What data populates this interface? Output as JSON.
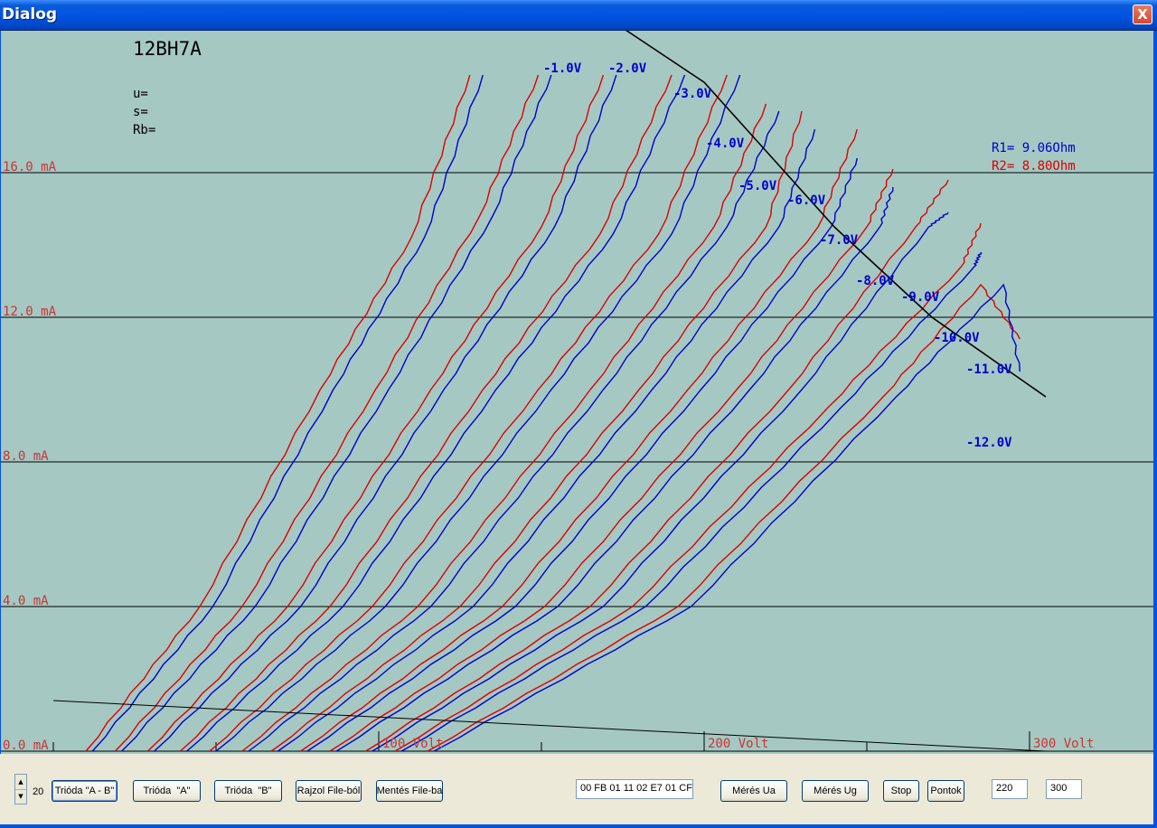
{
  "window": {
    "title": "Dialog",
    "close_label": "X"
  },
  "plot": {
    "tube_name": "12BH7A",
    "params": [
      "u=",
      "s=",
      "Rb="
    ],
    "r1_label": "R1= 9.06Ohm",
    "r2_label": "R2= 8.80Ohm",
    "y_tick_labels": [
      "16.0 mA",
      "12.0 mA",
      "8.0 mA",
      "4.0 mA",
      "0.0 mA"
    ],
    "x_tick_labels": [
      "100 Volt",
      "200 Volt",
      "300 Volt"
    ],
    "grid_labels": [
      "-1.0V",
      "-2.0V",
      "-3.0V",
      "-4.0V",
      "-5.0V",
      "-6.0V",
      "-7.0V",
      "-8.0V",
      "-9.0V",
      "-10.0V",
      "-11.0V",
      "-12.0V"
    ],
    "colors": {
      "background": "#a5c8c3",
      "triode_a": "#dd0000",
      "triode_b": "#0000cc",
      "axis_label": "#cc3333",
      "grid": "#000000"
    }
  },
  "chart_data": {
    "type": "line",
    "title": "12BH7A",
    "xlabel": "Volt",
    "ylabel": "mA",
    "xlim": [
      0,
      305
    ],
    "ylim": [
      0,
      16
    ],
    "x_ticks": [
      100,
      200,
      300
    ],
    "y_ticks": [
      0,
      4,
      8,
      12,
      16
    ],
    "grid": true,
    "series": [
      {
        "name": "-1.0V",
        "curves": [
          {
            "trace": "A",
            "points": [
              [
                10,
                0
              ],
              [
                45,
                4
              ],
              [
                82,
                10
              ],
              [
                110,
                14.2
              ],
              [
                128,
                18.7
              ]
            ]
          },
          {
            "trace": "B",
            "points": [
              [
                12,
                0
              ],
              [
                49,
                4
              ],
              [
                86,
                10
              ],
              [
                114,
                14.2
              ],
              [
                132,
                18.7
              ]
            ]
          }
        ]
      },
      {
        "name": "-2.0V",
        "curves": [
          {
            "trace": "A",
            "points": [
              [
                19,
                0
              ],
              [
                58,
                4
              ],
              [
                99,
                10
              ],
              [
                131,
                14.8
              ],
              [
                149,
                18.7
              ]
            ]
          },
          {
            "trace": "B",
            "points": [
              [
                21,
                0
              ],
              [
                62,
                4
              ],
              [
                103,
                10
              ],
              [
                135,
                14.8
              ],
              [
                153,
                18.7
              ]
            ]
          }
        ]
      },
      {
        "name": "-3.0V",
        "curves": [
          {
            "trace": "A",
            "points": [
              [
                29,
                0
              ],
              [
                72,
                4
              ],
              [
                116,
                10
              ],
              [
                150,
                14.5
              ],
              [
                169,
                18.7
              ]
            ]
          },
          {
            "trace": "B",
            "points": [
              [
                31,
                0
              ],
              [
                76,
                4
              ],
              [
                120,
                10
              ],
              [
                154,
                14.5
              ],
              [
                173,
                18.7
              ]
            ]
          }
        ]
      },
      {
        "name": "-4.0V",
        "curves": [
          {
            "trace": "A",
            "points": [
              [
                39,
                0
              ],
              [
                85,
                4
              ],
              [
                132,
                10
              ],
              [
                168,
                14.3
              ],
              [
                190,
                18.7
              ]
            ]
          },
          {
            "trace": "B",
            "points": [
              [
                41,
                0
              ],
              [
                89,
                4
              ],
              [
                136,
                10
              ],
              [
                172,
                14.3
              ],
              [
                194,
                18.7
              ]
            ]
          }
        ]
      },
      {
        "name": "-5.0V",
        "curves": [
          {
            "trace": "A",
            "points": [
              [
                48,
                0
              ],
              [
                98,
                4
              ],
              [
                149,
                10
              ],
              [
                186,
                14.3
              ],
              [
                207,
                18.7
              ]
            ]
          },
          {
            "trace": "B",
            "points": [
              [
                50,
                0
              ],
              [
                102,
                4
              ],
              [
                153,
                10
              ],
              [
                190,
                14.3
              ],
              [
                211,
                18.7
              ]
            ]
          }
        ]
      },
      {
        "name": "-6.0V",
        "curves": [
          {
            "trace": "A",
            "points": [
              [
                58,
                0
              ],
              [
                112,
                4
              ],
              [
                165,
                10
              ],
              [
                203,
                14.5
              ],
              [
                219,
                17.9
              ]
            ]
          },
          {
            "trace": "B",
            "points": [
              [
                60,
                0
              ],
              [
                116,
                4
              ],
              [
                169,
                10
              ],
              [
                207,
                14.5
              ],
              [
                223,
                17.7
              ]
            ]
          }
        ]
      },
      {
        "name": "-7.0V",
        "curves": [
          {
            "trace": "A",
            "points": [
              [
                67,
                0
              ],
              [
                125,
                4
              ],
              [
                180,
                10
              ],
              [
                219,
                14.5
              ],
              [
                230,
                17.7
              ]
            ]
          },
          {
            "trace": "B",
            "points": [
              [
                69,
                0
              ],
              [
                129,
                4
              ],
              [
                184,
                10
              ],
              [
                223,
                14.5
              ],
              [
                234,
                17.2
              ]
            ]
          }
        ]
      },
      {
        "name": "-8.0V",
        "curves": [
          {
            "trace": "A",
            "points": [
              [
                76,
                0
              ],
              [
                138,
                4
              ],
              [
                195,
                10
              ],
              [
                235,
                14.5
              ],
              [
                247,
                17.2
              ]
            ]
          },
          {
            "trace": "B",
            "points": [
              [
                78,
                0
              ],
              [
                142,
                4
              ],
              [
                199,
                10
              ],
              [
                239,
                14.5
              ],
              [
                247,
                16.4
              ]
            ]
          }
        ]
      },
      {
        "name": "-9.0V",
        "curves": [
          {
            "trace": "A",
            "points": [
              [
                85,
                0
              ],
              [
                151,
                4
              ],
              [
                210,
                10
              ],
              [
                250,
                14.5
              ],
              [
                258,
                16.1
              ]
            ]
          },
          {
            "trace": "B",
            "points": [
              [
                87,
                0
              ],
              [
                155,
                4
              ],
              [
                214,
                10
              ],
              [
                254,
                14.5
              ],
              [
                258,
                15.6
              ]
            ]
          }
        ]
      },
      {
        "name": "-10.0V",
        "curves": [
          {
            "trace": "A",
            "points": [
              [
                96,
                0
              ],
              [
                165,
                4
              ],
              [
                226,
                10
              ],
              [
                265,
                14.5
              ],
              [
                275,
                15.8
              ]
            ]
          },
          {
            "trace": "B",
            "points": [
              [
                98,
                0
              ],
              [
                169,
                4
              ],
              [
                230,
                10
              ],
              [
                269,
                14.5
              ],
              [
                275,
                14.9
              ]
            ]
          }
        ]
      },
      {
        "name": "-11.0V",
        "curves": [
          {
            "trace": "A",
            "points": [
              [
                105,
                0
              ],
              [
                178,
                4
              ],
              [
                238,
                9.5
              ],
              [
                279,
                13.4
              ],
              [
                285,
                14.6
              ]
            ]
          },
          {
            "trace": "B",
            "points": [
              [
                107,
                0
              ],
              [
                182,
                4
              ],
              [
                242,
                9.5
              ],
              [
                283,
                13.4
              ],
              [
                285,
                13.8
              ]
            ]
          }
        ]
      },
      {
        "name": "-12.0V",
        "curves": [
          {
            "trace": "A",
            "points": [
              [
                115,
                0
              ],
              [
                192,
                4
              ],
              [
                255,
                9.8
              ],
              [
                285,
                12.9
              ],
              [
                297,
                11.4
              ]
            ]
          },
          {
            "trace": "B",
            "points": [
              [
                117,
                0
              ],
              [
                196,
                4
              ],
              [
                259,
                9.8
              ],
              [
                292,
                12.9
              ],
              [
                297,
                10.5
              ]
            ]
          }
        ]
      }
    ],
    "load_line_hyperbola": [
      [
        175,
        20
      ],
      [
        200,
        18.5
      ],
      [
        240,
        14.5
      ],
      [
        270,
        12
      ],
      [
        305,
        9.8
      ]
    ],
    "load_line": [
      [
        0,
        1.4
      ],
      [
        305,
        0
      ]
    ]
  },
  "controls": {
    "spin_value": "20",
    "buttons": {
      "trioda_ab": "Trióda \"A - B\"",
      "trioda_a": "Trióda  \"A\"",
      "trioda_b": "Trióda  \"B\"",
      "rajzol": "Rajzol File-ból",
      "mentes": "Mentés File-ba",
      "meres_ua": "Mérés Ua",
      "meres_ug": "Mérés Ug",
      "stop": "Stop",
      "pontok": "Pontok"
    },
    "hex_field": "00 FB 01 11 02 E7 01 CF",
    "field_1": "220",
    "field_2": "300"
  }
}
